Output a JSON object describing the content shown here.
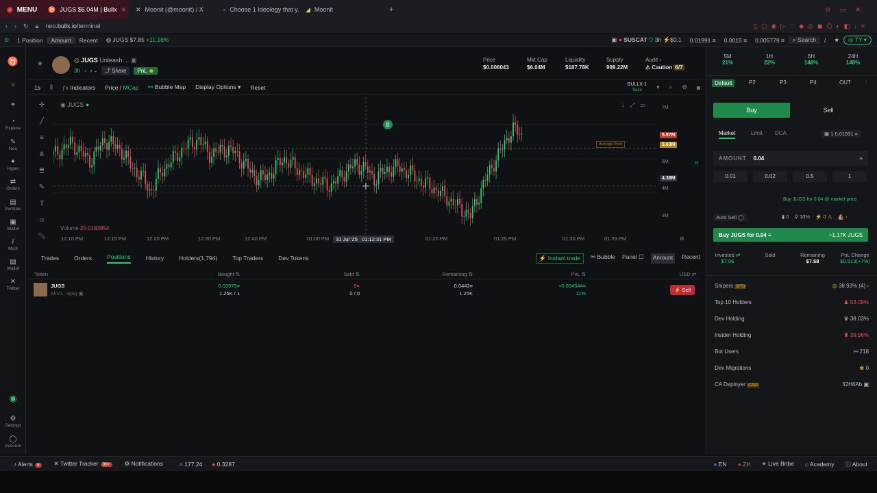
{
  "browser": {
    "menu_label": "MENU",
    "tabs": [
      {
        "label": "JUGS $6.04M | Bullx",
        "icon": "bullx-icon"
      },
      {
        "label": "Moonit (@moonit) / X",
        "icon": "x-icon"
      },
      {
        "label": "Choose 1 Ideology that y...",
        "icon": "doc-icon"
      },
      {
        "label": "Moonit",
        "icon": "moonit-icon"
      }
    ],
    "url_host": "neo.",
    "url_domain": "bullx.io",
    "url_path": "/terminal"
  },
  "topbar": {
    "position": "1 Position",
    "amount": "Amount",
    "recent": "Recent",
    "ticker_token": "JUGS",
    "ticker_price": "$7.85",
    "ticker_change": "+11.16%",
    "alert_token": "SUSCAT",
    "alert_age": "3h",
    "alert_val": "$0.1",
    "bal1": "0.01991",
    "bal2": "0.0015",
    "bal3": "0.005779",
    "search": "Search",
    "ty": "TY"
  },
  "token": {
    "symbol": "JUGS",
    "name": "Unleash ...",
    "age": "3h",
    "share": "Share",
    "pnl": "PnL",
    "stats": [
      {
        "label": "Price",
        "value": "$0.006043"
      },
      {
        "label": "Mkt Cap",
        "value": "$6.04M"
      },
      {
        "label": "Liquidity",
        "value": "$187.78K"
      },
      {
        "label": "Supply",
        "value": "999.22M"
      },
      {
        "label": "Audit",
        "value": "Caution",
        "extra": "6/7"
      }
    ]
  },
  "toolbar": {
    "interval": "1s",
    "indicators": "Indicators",
    "price": "Price",
    "mcap": "MCap",
    "bubble_map": "Bubble Map",
    "display_options": "Display Options",
    "reset": "Reset",
    "layout_name": "BULLX-1",
    "layout_sub": "Save"
  },
  "chart_data": {
    "type": "candlestick",
    "symbol": "JUGS",
    "volume_label": "Volume",
    "volume_value": "20.0183854",
    "x_ticks": [
      "12:10 PM",
      "12:15 PM",
      "12:20 PM",
      "12:30 PM",
      "12:40 PM",
      "01:00 PM",
      "01:20 PM",
      "01:25 PM",
      "01:30 PM",
      "01:33 PM"
    ],
    "crosshair_time": "31 Jul '25   01:12:31 PM",
    "y_ticks": [
      "7M",
      "5M",
      "4M",
      "3M"
    ],
    "price_labels": [
      {
        "value": "5.97M",
        "color": "#c0392b"
      },
      {
        "value": "5.63M",
        "color": "#b8860b"
      },
      {
        "value": "4.38M",
        "color": "#333a44"
      }
    ],
    "average_price_label": "Average Price",
    "marker": "B",
    "ylim": [
      2800000,
      7300000
    ],
    "close_series": [
      5.4,
      5.8,
      5.2,
      5.9,
      5.6,
      5.0,
      4.6,
      4.2,
      4.9,
      5.3,
      5.7,
      5.9,
      5.4,
      5.6,
      5.5,
      5.0,
      4.6,
      4.8,
      5.3,
      5.0,
      4.7,
      4.5,
      4.4,
      4.8,
      5.1,
      4.9,
      4.6,
      4.9,
      5.0,
      4.8,
      4.5,
      4.3,
      4.0,
      3.7,
      3.4,
      3.9,
      4.6,
      5.2,
      5.7,
      6.3,
      6.0
    ],
    "time_position": [
      0,
      0.03,
      0.06,
      0.085,
      0.11,
      0.13,
      0.15,
      0.16,
      0.18,
      0.2,
      0.22,
      0.24,
      0.26,
      0.28,
      0.3,
      0.32,
      0.34,
      0.36,
      0.38,
      0.4,
      0.42,
      0.44,
      0.46,
      0.48,
      0.5,
      0.52,
      0.53,
      0.55,
      0.57,
      0.59,
      0.61,
      0.63,
      0.65,
      0.67,
      0.69,
      0.7,
      0.715,
      0.73,
      0.745,
      0.76,
      0.775
    ]
  },
  "bottom": {
    "tabs": [
      "Trades",
      "Orders",
      "Positions",
      "History",
      "Holders(1,794)",
      "Top Traders",
      "Dev Tokens"
    ],
    "instant_trade": "Instant trade",
    "bubble": "Bubble",
    "panel": "Panel",
    "amount": "Amount",
    "recent": "Recent",
    "headers": [
      "Token",
      "Bought",
      "Sold",
      "Remaining",
      "PnL",
      "USD"
    ],
    "position": {
      "token": "JUGS",
      "addr": "AhV3...9gag",
      "bought": "0.03975",
      "bought_sub": "1.25K / 1",
      "sold": "0",
      "sold_sub": "0 / 0",
      "remaining": "0.0443",
      "remaining_sub": "1.25K",
      "pnl": "+0.004544",
      "pnl_pct": "11%",
      "sell": "Sell"
    }
  },
  "right": {
    "timeframes": [
      {
        "label": "5M",
        "value": "21%"
      },
      {
        "label": "1H",
        "value": "22%"
      },
      {
        "label": "6H",
        "value": "148%"
      },
      {
        "label": "24H",
        "value": "148%"
      }
    ],
    "presets": [
      "Default",
      "P2",
      "P3",
      "P4",
      "OUT"
    ],
    "buy": "Buy",
    "sell": "Sell",
    "order_types": [
      "Market",
      "Limit",
      "DCA"
    ],
    "wallet_count": "1",
    "wallet_bal": "0.01991",
    "amount_label": "AMOUNT",
    "amount_value": "0.04",
    "quick": [
      "0.01",
      "0.02",
      "0.5",
      "1"
    ],
    "market_note": "Buy JUGS for 0.04 @ market price",
    "auto_sell": "Auto Sell",
    "slip_a": "0",
    "slip_b": "10%",
    "slip_c": "0",
    "buy_btn": "Buy JUGS for 0.04",
    "buy_btn_est": "~1.17K JUGS",
    "summary": [
      {
        "label": "Invested",
        "value": "$7.06"
      },
      {
        "label": "Sold",
        "value": ""
      },
      {
        "label": "Remaining",
        "value": "$7.58"
      },
      {
        "label": "PnL Change",
        "value": "$0.513(+7%)"
      }
    ],
    "metrics": [
      {
        "label": "Snipers",
        "tag": "8/70",
        "value": "38.93% (4)"
      },
      {
        "label": "Top 10 Holders",
        "value": "53.09%"
      },
      {
        "label": "Dev Holding",
        "value": "38.03%"
      },
      {
        "label": "Insider Holding",
        "value": "39.96%"
      },
      {
        "label": "Bot Users",
        "value": "218"
      },
      {
        "label": "Dev Migrations",
        "value": "0"
      },
      {
        "label": "CA Deployer",
        "tag": "CAD",
        "value": "32H6Ab"
      }
    ]
  },
  "rail": [
    "Explore",
    "Neo",
    "Hyper",
    "Orders",
    "Portfolio",
    "Wallet",
    "Multi",
    "Wallet",
    "Twitter",
    "Settings",
    "Account"
  ],
  "status": {
    "alerts": "Alerts",
    "alerts_badge": "9",
    "twitter": "Twitter Tracker",
    "twitter_badge": "99+",
    "notifications": "Notifications",
    "sol_price": "177.24",
    "other_price": "0.3287",
    "lang1": "EN",
    "lang2": "ZH",
    "live_bribe": "Live Bribe",
    "academy": "Academy",
    "about": "About"
  }
}
